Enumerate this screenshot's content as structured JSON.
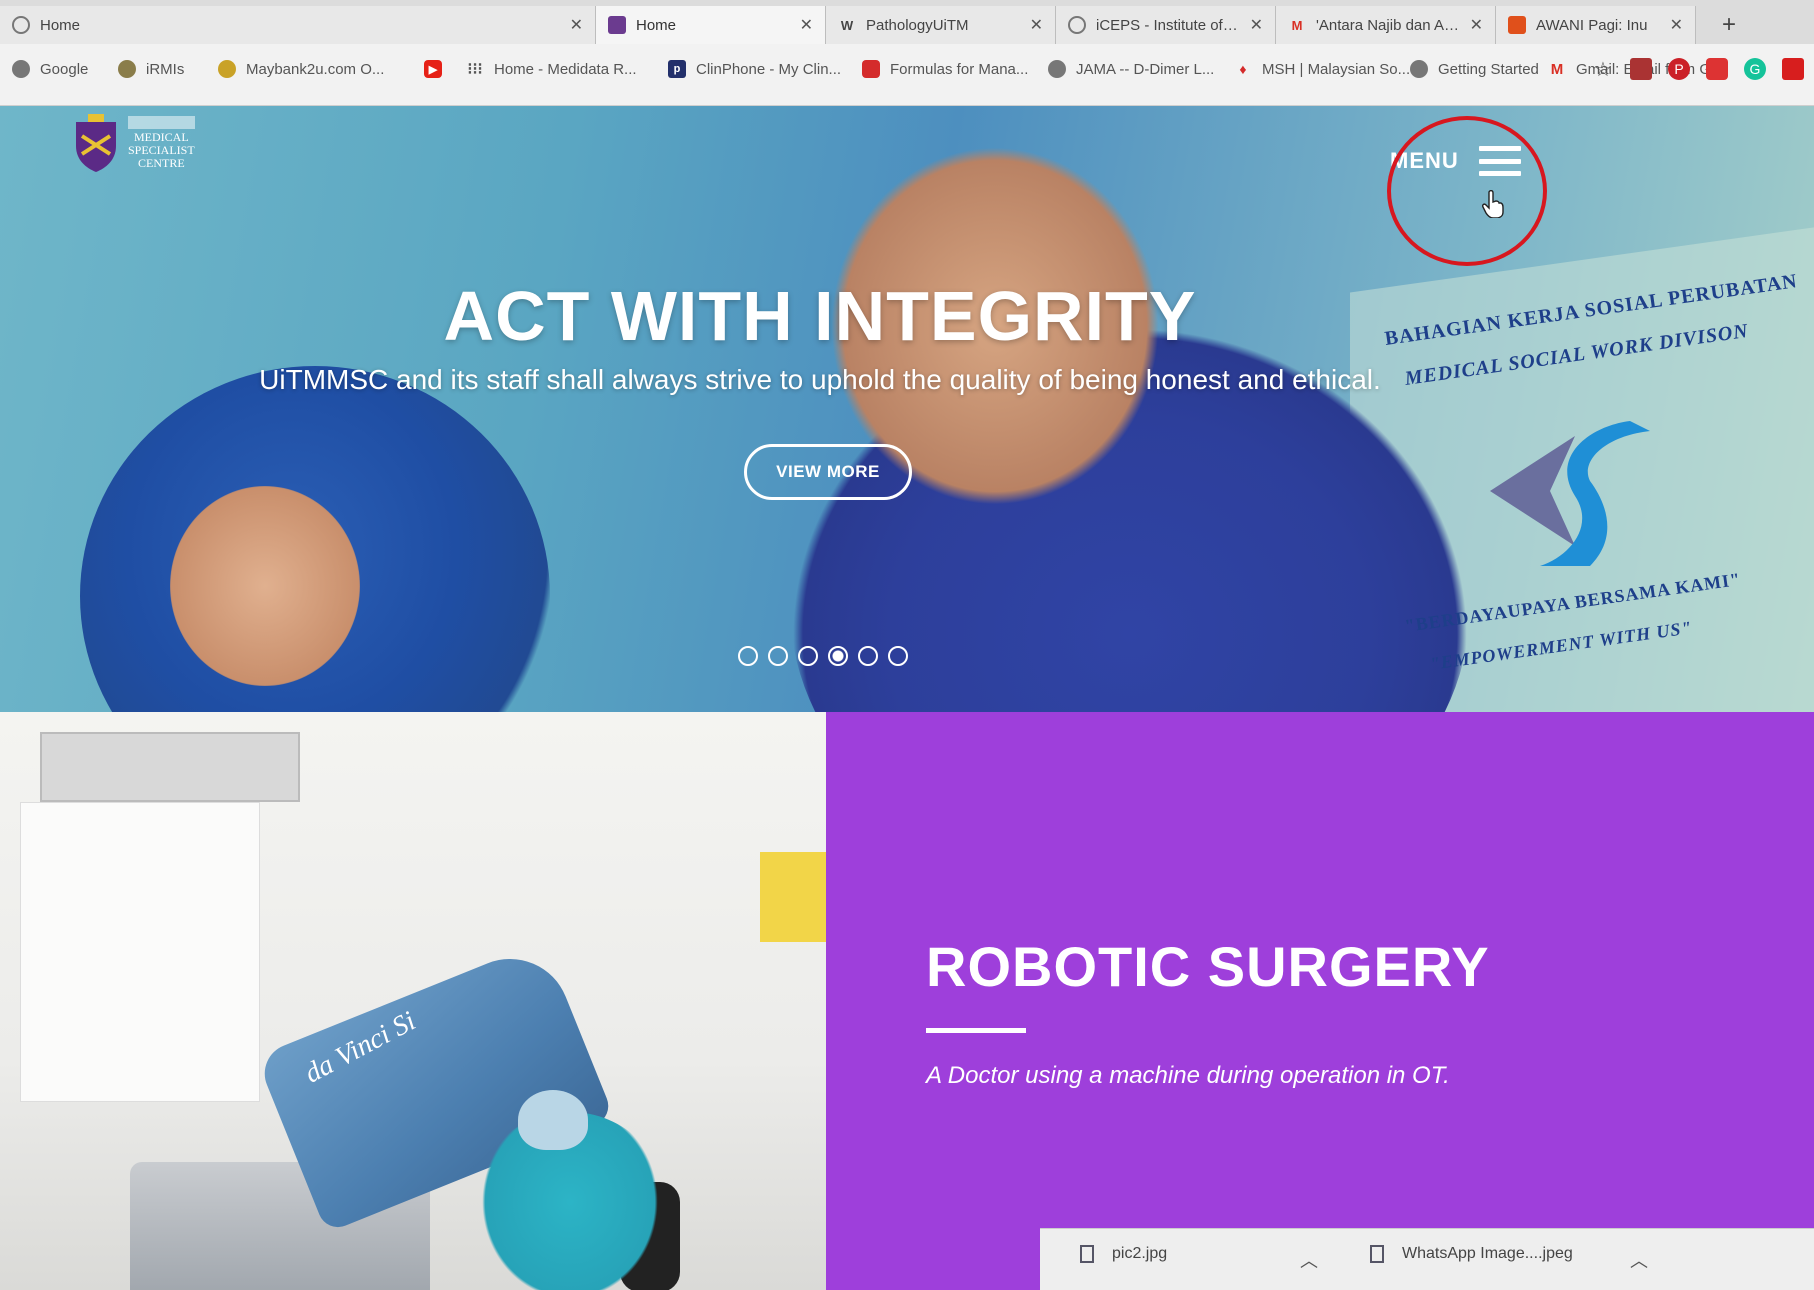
{
  "tabs": [
    {
      "title": "Home",
      "active": false
    },
    {
      "title": "Home",
      "active": true
    },
    {
      "title": "PathologyUiTM",
      "active": false
    },
    {
      "title": "iCEPS - Institute of Cor",
      "active": false
    },
    {
      "title": "'Antara Najib dan Anw",
      "active": false
    },
    {
      "title": "AWANI Pagi: Inu",
      "active": false
    }
  ],
  "bookmarks": [
    {
      "label": "Google"
    },
    {
      "label": "iRMIs"
    },
    {
      "label": "Maybank2u.com O..."
    },
    {
      "label": ""
    },
    {
      "label": "Home - Medidata R..."
    },
    {
      "label": "ClinPhone - My Clin..."
    },
    {
      "label": "Formulas for Mana..."
    },
    {
      "label": "JAMA -- D-Dimer L..."
    },
    {
      "label": "MSH | Malaysian So..."
    },
    {
      "label": "Getting Started"
    },
    {
      "label": "Gmail: Email from G..."
    }
  ],
  "site": {
    "logo_lines": [
      "MEDICAL",
      "SPECIALIST",
      "CENTRE"
    ],
    "menu_label": "MENU"
  },
  "hero": {
    "title": "ACT WITH INTEGRITY",
    "subtitle": "UiTMMSC and its staff shall always strive to uphold the quality of being honest and ethical.",
    "button": "VIEW MORE",
    "slides_total": 6,
    "slide_active": 4,
    "wall_lines": [
      "BAHAGIAN KERJA SOSIAL PERUBATAN",
      "MEDICAL SOCIAL WORK DIVISON",
      "\"BERDAYAUPAYA BERSAMA KAMI\"",
      "\"EMPOWERMENT WITH US\""
    ]
  },
  "feature": {
    "title": "ROBOTIC SURGERY",
    "caption": "A Doctor using a machine during operation in OT.",
    "machine_label": "da Vinci Si"
  },
  "downloads": [
    {
      "name": "pic2.jpg"
    },
    {
      "name": "WhatsApp Image....jpeg"
    }
  ],
  "colors": {
    "purple": "#9e3fdb",
    "highlight_circle": "#d7171f"
  }
}
